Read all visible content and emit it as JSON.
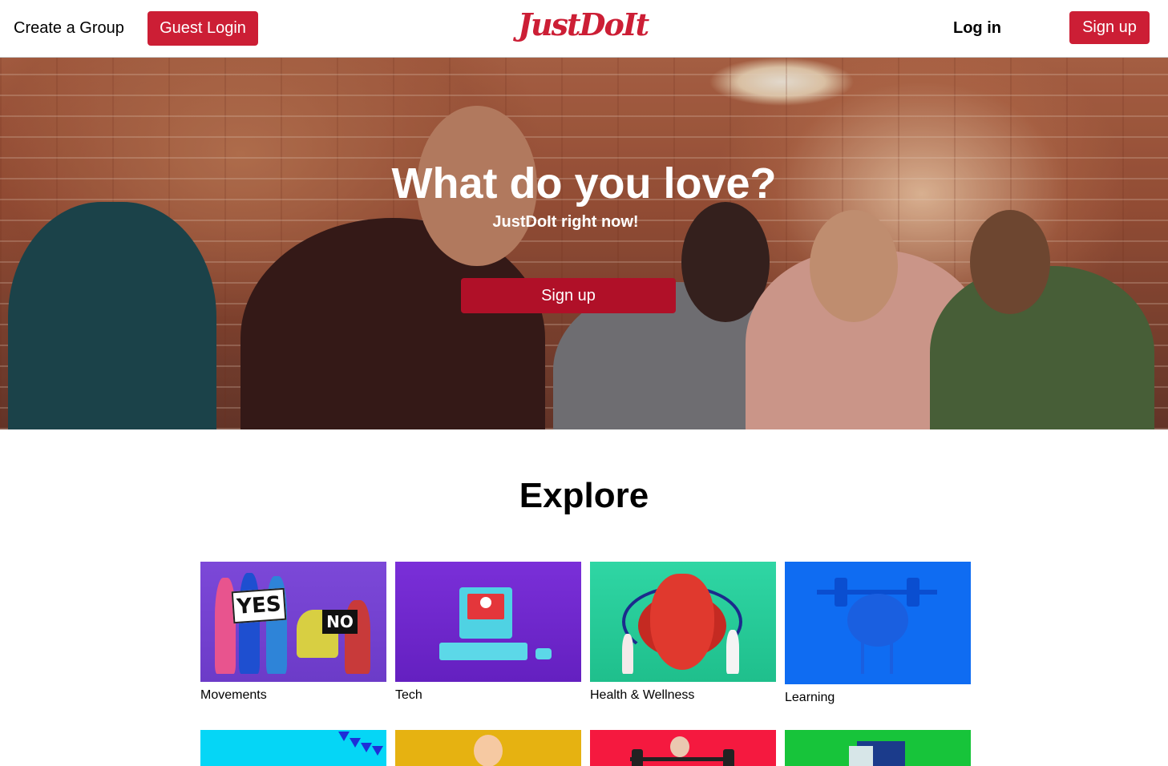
{
  "header": {
    "create_group": "Create a Group",
    "guest_login": "Guest Login",
    "logo": "JustDoIt",
    "login": "Log in",
    "signup": "Sign up"
  },
  "hero": {
    "title": "What do you love?",
    "subtitle": "JustDoIt right now!",
    "signup": "Sign up"
  },
  "explore": {
    "title": "Explore",
    "categories": [
      {
        "label": "Movements"
      },
      {
        "label": "Tech"
      },
      {
        "label": "Health & Wellness"
      },
      {
        "label": "Learning"
      }
    ],
    "movement_signs": [
      "YES",
      "NO"
    ]
  },
  "colors": {
    "brand_red": "#cc1e35",
    "hero_button": "#b01028"
  }
}
